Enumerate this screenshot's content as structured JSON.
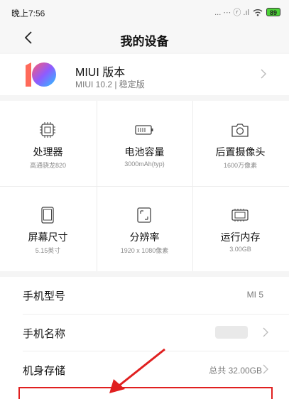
{
  "status_bar": {
    "time": "晚上7:56",
    "icons": "... ⋯ ⓡ .ıl",
    "battery": "89"
  },
  "nav": {
    "title": "我的设备"
  },
  "version": {
    "name": "MIUI 版本",
    "detail": "MIUI 10.2 | 稳定版"
  },
  "specs": [
    {
      "label": "处理器",
      "value": "高通骁龙820"
    },
    {
      "label": "电池容量",
      "value": "3000mAh(typ)"
    },
    {
      "label": "后置摄像头",
      "value": "1600万像素"
    },
    {
      "label": "屏幕尺寸",
      "value": "5.15英寸"
    },
    {
      "label": "分辨率",
      "value": "1920 x 1080像素"
    },
    {
      "label": "运行内存",
      "value": "3.00GB"
    }
  ],
  "rows": [
    {
      "key": "手机型号",
      "value": "MI 5"
    },
    {
      "key": "手机名称",
      "value": ""
    },
    {
      "key": "机身存储",
      "value": "总共 32.00GB"
    }
  ],
  "colors": {
    "highlight": "#e02020",
    "battery": "#4cd137"
  }
}
